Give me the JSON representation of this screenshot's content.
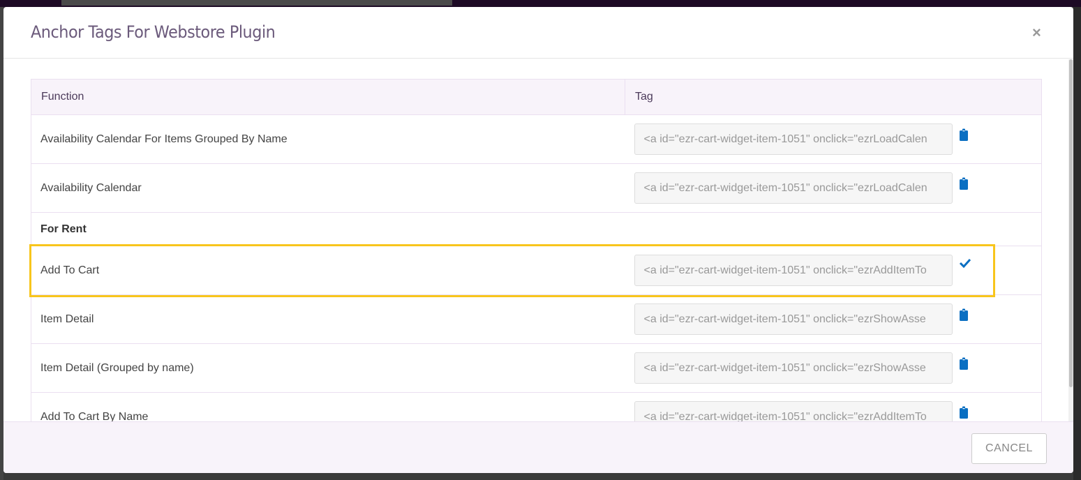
{
  "modal": {
    "title": "Anchor Tags For Webstore Plugin",
    "close_label": "×"
  },
  "table": {
    "headers": [
      "Function",
      "Tag"
    ],
    "rows": [
      {
        "function": "Availability Calendar For Items Grouped By Name",
        "tag": "<a id=\"ezr-cart-widget-item-1051\" onclick=\"ezrLoadCalen",
        "icon": "clipboard-icon"
      },
      {
        "function": "Availability Calendar",
        "tag": "<a id=\"ezr-cart-widget-item-1051\" onclick=\"ezrLoadCalen",
        "icon": "clipboard-icon"
      },
      {
        "group": "For Rent"
      },
      {
        "function": "Add To Cart",
        "tag": "<a id=\"ezr-cart-widget-item-1051\" onclick=\"ezrAddItemTo",
        "icon": "check-icon",
        "highlighted": true
      },
      {
        "function": "Item Detail",
        "tag": "<a id=\"ezr-cart-widget-item-1051\" onclick=\"ezrShowAsse",
        "icon": "clipboard-icon"
      },
      {
        "function": "Item Detail (Grouped by name)",
        "tag": "<a id=\"ezr-cart-widget-item-1051\" onclick=\"ezrShowAsse",
        "icon": "clipboard-icon"
      },
      {
        "function": "Add To Cart By Name",
        "tag": "<a id=\"ezr-cart-widget-item-1051\" onclick=\"ezrAddItemTo",
        "icon": "clipboard-icon"
      }
    ]
  },
  "footer": {
    "cancel_label": "CANCEL"
  },
  "colors": {
    "icon": "#0a6fc2",
    "highlight": "#f8c51c",
    "title": "#6b5a7b"
  }
}
